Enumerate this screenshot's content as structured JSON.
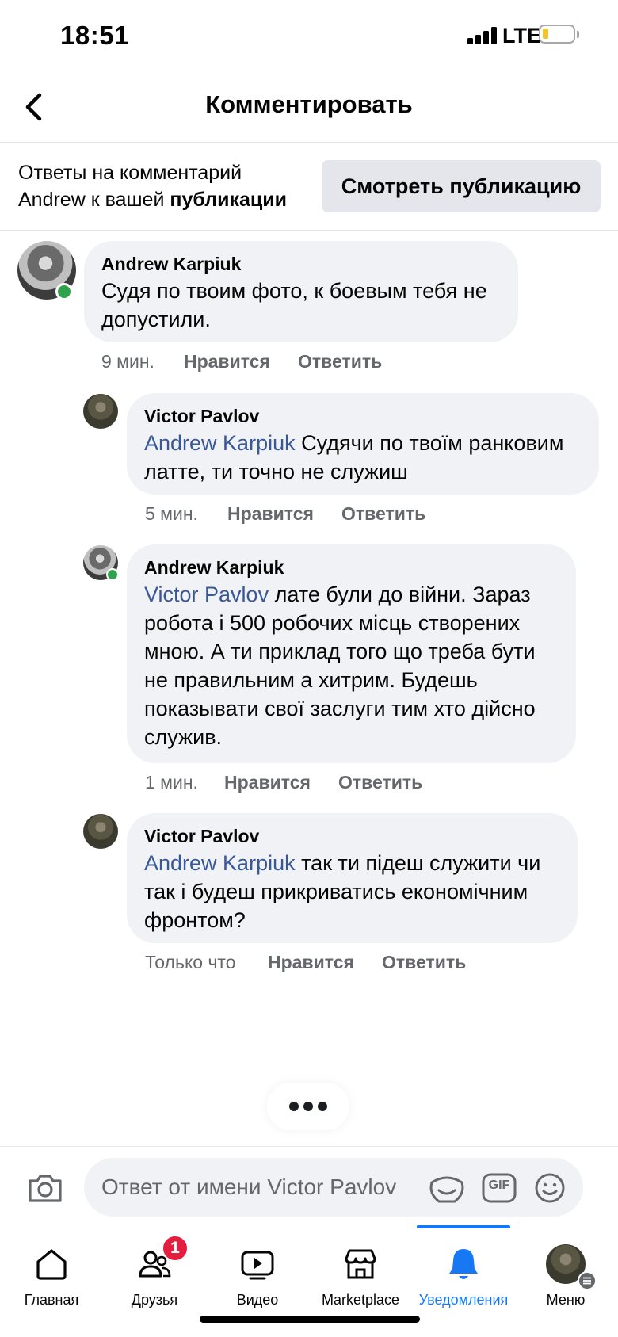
{
  "status": {
    "time": "18:51",
    "network": "LTE",
    "battery_level": 0.15,
    "battery_color": "#f2c230"
  },
  "header": {
    "title": "Комментировать",
    "back_icon": "chevron-left-icon"
  },
  "banner": {
    "text_line1": "Ответы на комментарий",
    "text_line2_plain": "Andrew к вашей ",
    "text_line2_bold": "публикации",
    "button_label": "Смотреть публикацию"
  },
  "comments": [
    {
      "author": "Andrew Karpiuk",
      "mention": "",
      "text": "Судя по твоим фото, к боевым тебя не допустили.",
      "time": "9 мин.",
      "like": "Нравится",
      "reply": "Ответить",
      "online": true
    },
    {
      "author": "Victor Pavlov",
      "mention": "Andrew Karpiuk",
      "text": " Судячи по твоїм ранковим латте, ти точно не служиш",
      "time": "5 мин.",
      "like": "Нравится",
      "reply": "Ответить",
      "online": false
    },
    {
      "author": "Andrew Karpiuk",
      "mention": "Victor Pavlov",
      "text": " лате були до війни. Зараз робота і 500 робочих місць створених мною. А ти приклад того що треба бути не правильним а хитрим. Будешь показывати свої заслуги тим хто дійсно служив.",
      "time": "1 мин.",
      "like": "Нравится",
      "reply": "Ответить",
      "online": true
    },
    {
      "author": "Victor Pavlov",
      "mention": "Andrew Karpiuk",
      "text": " так ти підеш служити чи так і будеш прикриватись економічним фронтом?",
      "time": "Только что",
      "like": "Нравится",
      "reply": "Ответить",
      "online": false
    }
  ],
  "composer": {
    "placeholder": "Ответ от имени Victor Pavlov",
    "gif_label": "GIF",
    "icons": [
      "camera-icon",
      "sticker-icon",
      "gif-icon",
      "emoji-icon"
    ]
  },
  "tabs": [
    {
      "label": "Главная",
      "icon": "home-icon",
      "badge": ""
    },
    {
      "label": "Друзья",
      "icon": "friends-icon",
      "badge": "1"
    },
    {
      "label": "Видео",
      "icon": "video-icon",
      "badge": ""
    },
    {
      "label": "Marketplace",
      "icon": "marketplace-icon",
      "badge": ""
    },
    {
      "label": "Уведомления",
      "icon": "bell-icon",
      "badge": "",
      "active": true
    },
    {
      "label": "Меню",
      "icon": "menu-avatar-icon",
      "badge": ""
    }
  ],
  "colors": {
    "accent": "#1877f2",
    "mention": "#385898",
    "bubble": "#f0f2f5",
    "online": "#31a24c",
    "badge": "#e41e3f"
  }
}
